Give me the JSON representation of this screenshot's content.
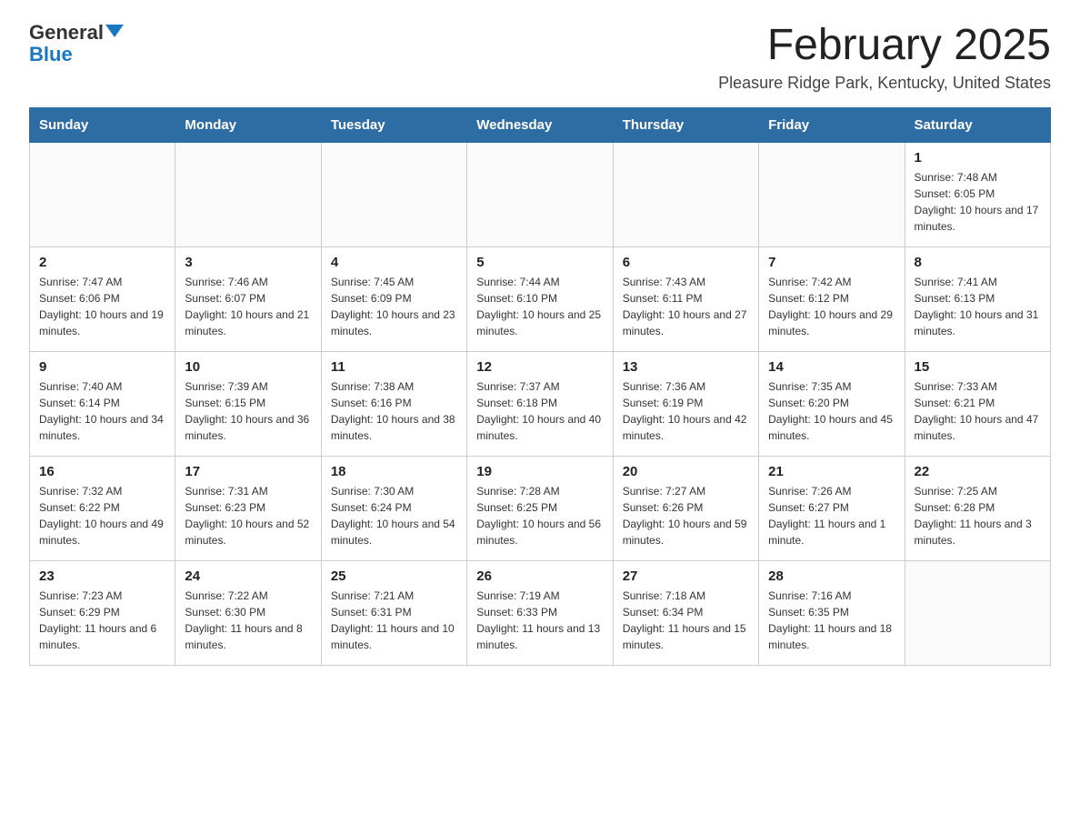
{
  "logo": {
    "general": "General",
    "blue": "Blue"
  },
  "title": "February 2025",
  "subtitle": "Pleasure Ridge Park, Kentucky, United States",
  "days_of_week": [
    "Sunday",
    "Monday",
    "Tuesday",
    "Wednesday",
    "Thursday",
    "Friday",
    "Saturday"
  ],
  "weeks": [
    [
      {
        "day": "",
        "info": ""
      },
      {
        "day": "",
        "info": ""
      },
      {
        "day": "",
        "info": ""
      },
      {
        "day": "",
        "info": ""
      },
      {
        "day": "",
        "info": ""
      },
      {
        "day": "",
        "info": ""
      },
      {
        "day": "1",
        "info": "Sunrise: 7:48 AM\nSunset: 6:05 PM\nDaylight: 10 hours and 17 minutes."
      }
    ],
    [
      {
        "day": "2",
        "info": "Sunrise: 7:47 AM\nSunset: 6:06 PM\nDaylight: 10 hours and 19 minutes."
      },
      {
        "day": "3",
        "info": "Sunrise: 7:46 AM\nSunset: 6:07 PM\nDaylight: 10 hours and 21 minutes."
      },
      {
        "day": "4",
        "info": "Sunrise: 7:45 AM\nSunset: 6:09 PM\nDaylight: 10 hours and 23 minutes."
      },
      {
        "day": "5",
        "info": "Sunrise: 7:44 AM\nSunset: 6:10 PM\nDaylight: 10 hours and 25 minutes."
      },
      {
        "day": "6",
        "info": "Sunrise: 7:43 AM\nSunset: 6:11 PM\nDaylight: 10 hours and 27 minutes."
      },
      {
        "day": "7",
        "info": "Sunrise: 7:42 AM\nSunset: 6:12 PM\nDaylight: 10 hours and 29 minutes."
      },
      {
        "day": "8",
        "info": "Sunrise: 7:41 AM\nSunset: 6:13 PM\nDaylight: 10 hours and 31 minutes."
      }
    ],
    [
      {
        "day": "9",
        "info": "Sunrise: 7:40 AM\nSunset: 6:14 PM\nDaylight: 10 hours and 34 minutes."
      },
      {
        "day": "10",
        "info": "Sunrise: 7:39 AM\nSunset: 6:15 PM\nDaylight: 10 hours and 36 minutes."
      },
      {
        "day": "11",
        "info": "Sunrise: 7:38 AM\nSunset: 6:16 PM\nDaylight: 10 hours and 38 minutes."
      },
      {
        "day": "12",
        "info": "Sunrise: 7:37 AM\nSunset: 6:18 PM\nDaylight: 10 hours and 40 minutes."
      },
      {
        "day": "13",
        "info": "Sunrise: 7:36 AM\nSunset: 6:19 PM\nDaylight: 10 hours and 42 minutes."
      },
      {
        "day": "14",
        "info": "Sunrise: 7:35 AM\nSunset: 6:20 PM\nDaylight: 10 hours and 45 minutes."
      },
      {
        "day": "15",
        "info": "Sunrise: 7:33 AM\nSunset: 6:21 PM\nDaylight: 10 hours and 47 minutes."
      }
    ],
    [
      {
        "day": "16",
        "info": "Sunrise: 7:32 AM\nSunset: 6:22 PM\nDaylight: 10 hours and 49 minutes."
      },
      {
        "day": "17",
        "info": "Sunrise: 7:31 AM\nSunset: 6:23 PM\nDaylight: 10 hours and 52 minutes."
      },
      {
        "day": "18",
        "info": "Sunrise: 7:30 AM\nSunset: 6:24 PM\nDaylight: 10 hours and 54 minutes."
      },
      {
        "day": "19",
        "info": "Sunrise: 7:28 AM\nSunset: 6:25 PM\nDaylight: 10 hours and 56 minutes."
      },
      {
        "day": "20",
        "info": "Sunrise: 7:27 AM\nSunset: 6:26 PM\nDaylight: 10 hours and 59 minutes."
      },
      {
        "day": "21",
        "info": "Sunrise: 7:26 AM\nSunset: 6:27 PM\nDaylight: 11 hours and 1 minute."
      },
      {
        "day": "22",
        "info": "Sunrise: 7:25 AM\nSunset: 6:28 PM\nDaylight: 11 hours and 3 minutes."
      }
    ],
    [
      {
        "day": "23",
        "info": "Sunrise: 7:23 AM\nSunset: 6:29 PM\nDaylight: 11 hours and 6 minutes."
      },
      {
        "day": "24",
        "info": "Sunrise: 7:22 AM\nSunset: 6:30 PM\nDaylight: 11 hours and 8 minutes."
      },
      {
        "day": "25",
        "info": "Sunrise: 7:21 AM\nSunset: 6:31 PM\nDaylight: 11 hours and 10 minutes."
      },
      {
        "day": "26",
        "info": "Sunrise: 7:19 AM\nSunset: 6:33 PM\nDaylight: 11 hours and 13 minutes."
      },
      {
        "day": "27",
        "info": "Sunrise: 7:18 AM\nSunset: 6:34 PM\nDaylight: 11 hours and 15 minutes."
      },
      {
        "day": "28",
        "info": "Sunrise: 7:16 AM\nSunset: 6:35 PM\nDaylight: 11 hours and 18 minutes."
      },
      {
        "day": "",
        "info": ""
      }
    ]
  ]
}
